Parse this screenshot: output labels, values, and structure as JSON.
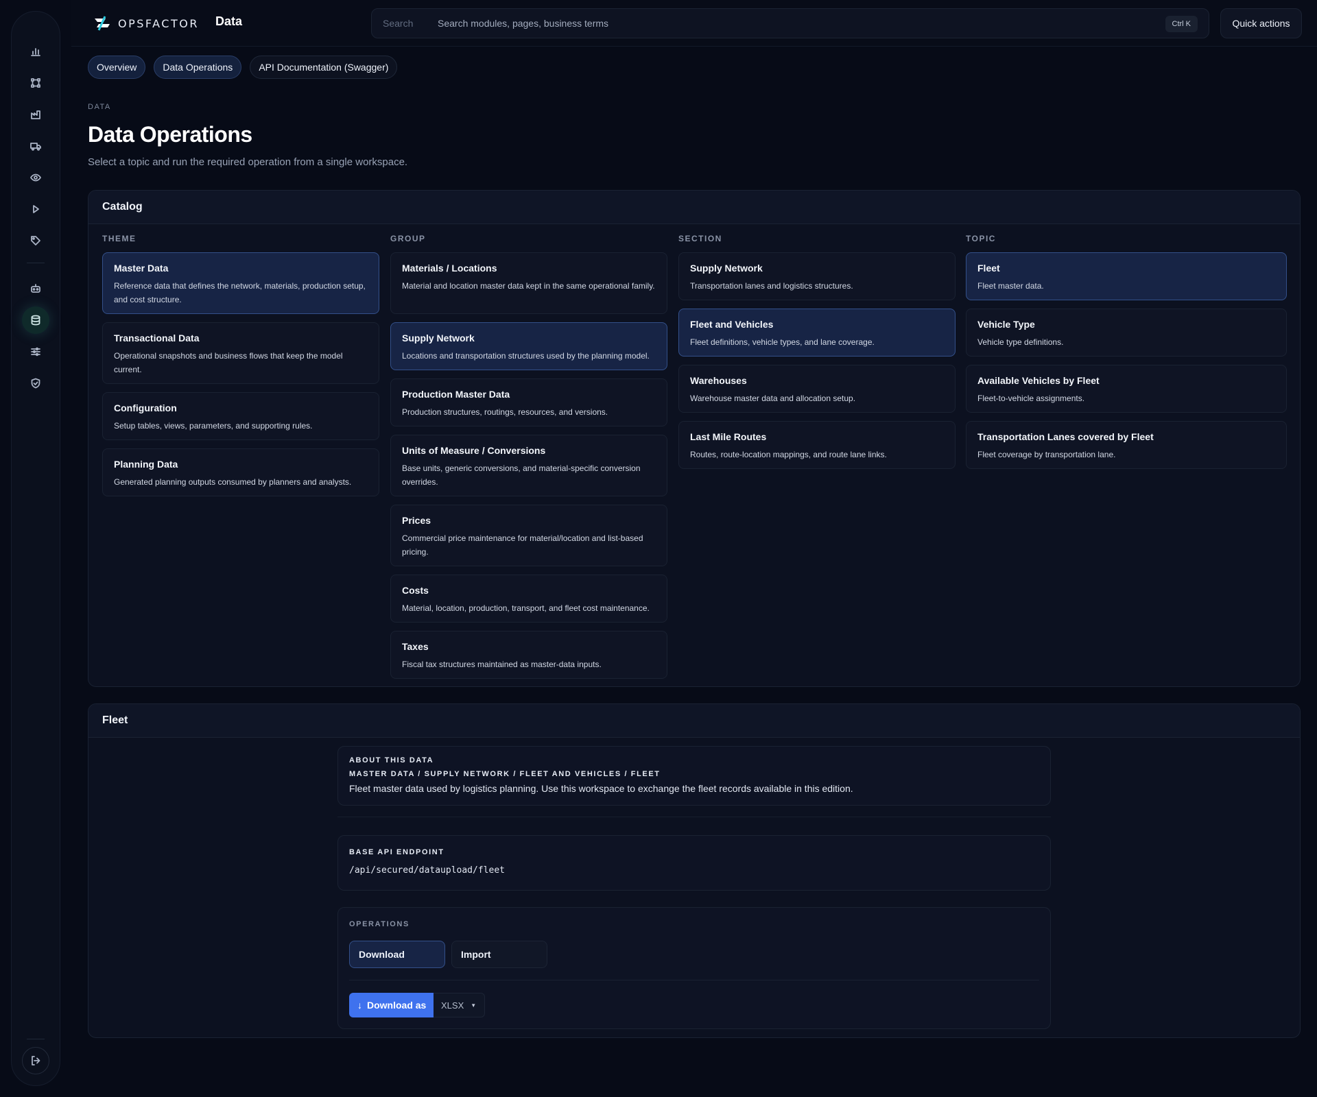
{
  "brand": {
    "name": "OPSFACTOR",
    "app": "Data"
  },
  "search": {
    "label": "Search",
    "placeholder": "Search modules, pages, business terms",
    "shortcut": "Ctrl K"
  },
  "quick_actions": "Quick actions",
  "sidebar": {
    "items": [
      {
        "icon": "bar-chart-icon"
      },
      {
        "icon": "network-icon"
      },
      {
        "icon": "factory-icon"
      },
      {
        "icon": "truck-icon"
      },
      {
        "icon": "eye-icon"
      },
      {
        "icon": "play-icon"
      },
      {
        "icon": "tag-icon"
      },
      {
        "icon": "robot-icon"
      },
      {
        "icon": "database-icon",
        "active": true
      },
      {
        "icon": "sliders-icon"
      },
      {
        "icon": "shield-icon"
      }
    ],
    "logout_icon": "logout-icon"
  },
  "tabs": [
    {
      "label": "Overview",
      "active": true
    },
    {
      "label": "Data Operations",
      "active": true
    },
    {
      "label": "API Documentation (Swagger)",
      "active": false
    }
  ],
  "page": {
    "eyebrow": "DATA",
    "title": "Data Operations",
    "subtitle": "Select a topic and run the required operation from a single workspace."
  },
  "catalog": {
    "title": "Catalog",
    "columns": {
      "theme": {
        "label": "THEME",
        "items": [
          {
            "title": "Master Data",
            "desc": "Reference data that defines the network, materials, production setup, and cost structure.",
            "selected": true
          },
          {
            "title": "Transactional Data",
            "desc": "Operational snapshots and business flows that keep the model current.",
            "selected": false
          },
          {
            "title": "Configuration",
            "desc": "Setup tables, views, parameters, and supporting rules.",
            "selected": false
          },
          {
            "title": "Planning Data",
            "desc": "Generated planning outputs consumed by planners and analysts.",
            "selected": false
          }
        ]
      },
      "group": {
        "label": "GROUP",
        "items": [
          {
            "title": "Materials / Locations",
            "desc": "Material and location master data kept in the same operational family.",
            "selected": false
          },
          {
            "title": "Supply Network",
            "desc": "Locations and transportation structures used by the planning model.",
            "selected": true
          },
          {
            "title": "Production Master Data",
            "desc": "Production structures, routings, resources, and versions.",
            "selected": false
          },
          {
            "title": "Units of Measure / Conversions",
            "desc": "Base units, generic conversions, and material-specific conversion overrides.",
            "selected": false
          },
          {
            "title": "Prices",
            "desc": "Commercial price maintenance for material/location and list-based pricing.",
            "selected": false
          },
          {
            "title": "Costs",
            "desc": "Material, location, production, transport, and fleet cost maintenance.",
            "selected": false
          },
          {
            "title": "Taxes",
            "desc": "Fiscal tax structures maintained as master-data inputs.",
            "selected": false
          }
        ]
      },
      "section": {
        "label": "SECTION",
        "items": [
          {
            "title": "Supply Network",
            "desc": "Transportation lanes and logistics structures.",
            "selected": false
          },
          {
            "title": "Fleet and Vehicles",
            "desc": "Fleet definitions, vehicle types, and lane coverage.",
            "selected": true
          },
          {
            "title": "Warehouses",
            "desc": "Warehouse master data and allocation setup.",
            "selected": false
          },
          {
            "title": "Last Mile Routes",
            "desc": "Routes, route-location mappings, and route lane links.",
            "selected": false
          }
        ]
      },
      "topic": {
        "label": "TOPIC",
        "items": [
          {
            "title": "Fleet",
            "desc": "Fleet master data.",
            "selected": true
          },
          {
            "title": "Vehicle Type",
            "desc": "Vehicle type definitions.",
            "selected": false
          },
          {
            "title": "Available Vehicles by Fleet",
            "desc": "Fleet-to-vehicle assignments.",
            "selected": false
          },
          {
            "title": "Transportation Lanes covered by Fleet",
            "desc": "Fleet coverage by transportation lane.",
            "selected": false
          }
        ]
      }
    }
  },
  "detail": {
    "title": "Fleet",
    "about_label": "ABOUT THIS DATA",
    "path": "MASTER DATA / SUPPLY NETWORK / FLEET AND VEHICLES / FLEET",
    "description": "Fleet master data used by logistics planning. Use this workspace to exchange the fleet records available in this edition.",
    "endpoint_label": "BASE API ENDPOINT",
    "endpoint": "/api/secured/dataupload/fleet",
    "operations_label": "OPERATIONS",
    "operations": [
      {
        "label": "Download",
        "active": true
      },
      {
        "label": "Import",
        "active": false
      }
    ],
    "download_button": "Download as",
    "format": "XLSX"
  },
  "colors": {
    "accent": "#3f72ee",
    "selected_bg": "#172445",
    "selected_border": "#33508a",
    "background": "#070b17"
  }
}
